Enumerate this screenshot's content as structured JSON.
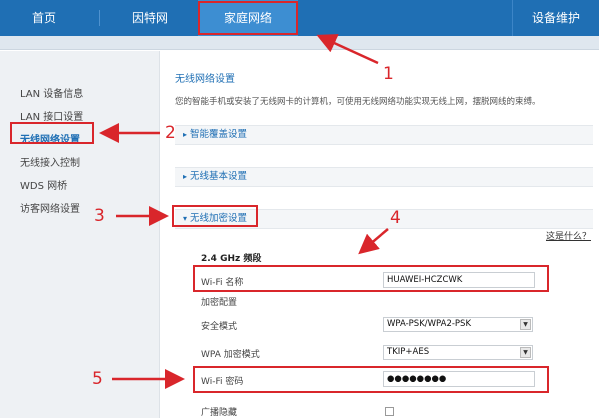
{
  "nav": {
    "home": "首页",
    "internet": "因特网",
    "home_network": "家庭网络",
    "device": "设备维护"
  },
  "sidebar": {
    "items": [
      {
        "label": "LAN 设备信息"
      },
      {
        "label": "LAN 接口设置"
      },
      {
        "label": "无线网络设置"
      },
      {
        "label": "无线接入控制"
      },
      {
        "label": "WDS 网桥"
      },
      {
        "label": "访客网络设置"
      }
    ]
  },
  "main": {
    "title": "无线网络设置",
    "description": "您的智能手机或安装了无线网卡的计算机，可使用无线网络功能实现无线上网，摆脱网线的束缚。",
    "sections": {
      "coverage": "智能覆盖设置",
      "basic": "无线基本设置",
      "encryption": "无线加密设置"
    },
    "help_link": "这是什么？",
    "band_title": "2.4 GHz 频段",
    "wifi_name_label": "Wi-Fi 名称",
    "wifi_name_value": "HUAWEI-HCZCWK",
    "encryption_config": "加密配置",
    "security_mode_label": "安全模式",
    "security_mode_value": "WPA-PSK/WPA2-PSK",
    "wpa_encryption_label": "WPA 加密模式",
    "wpa_encryption_value": "TKIP+AES",
    "wifi_password_label": "Wi-Fi 密码",
    "wifi_password_value": "●●●●●●●●",
    "broadcast_hide_label": "广播隐藏"
  },
  "annotations": [
    "1",
    "2",
    "3",
    "4",
    "5"
  ],
  "colors": {
    "nav_blue": "#1f6fb4",
    "annotation_red": "#d9262b"
  }
}
